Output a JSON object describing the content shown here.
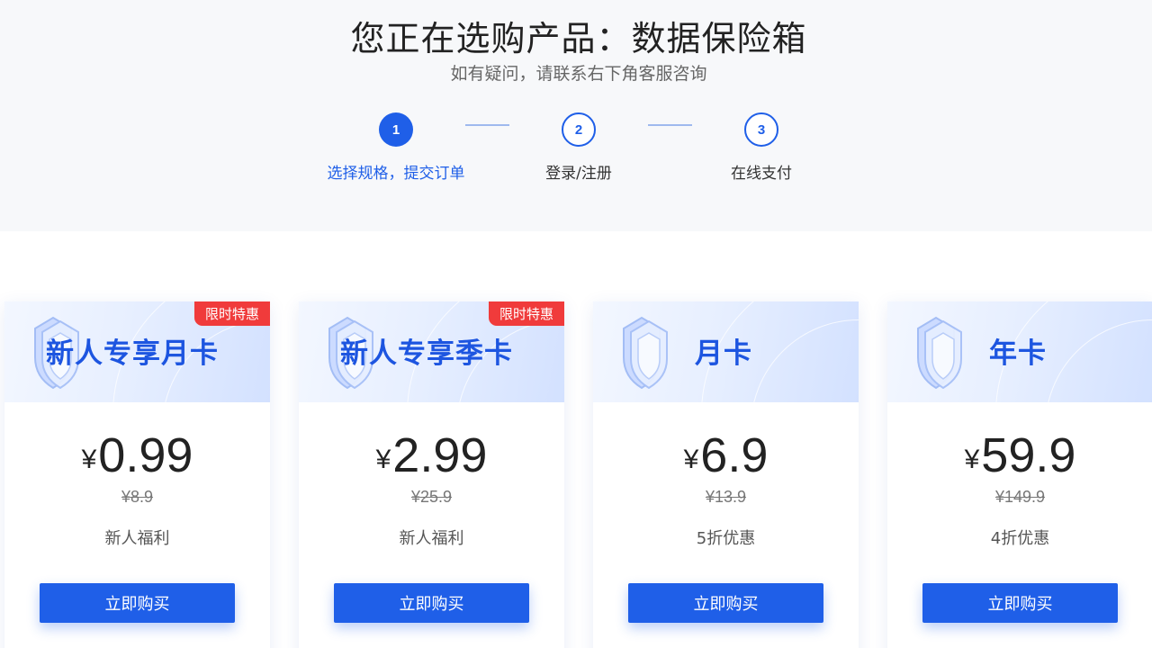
{
  "header": {
    "title": "您正在选购产品：数据保险箱",
    "subtitle": "如有疑问，请联系右下角客服咨询"
  },
  "steps": [
    {
      "number": "1",
      "label": "选择规格，提交订单",
      "state": "active"
    },
    {
      "number": "2",
      "label": "登录/注册",
      "state": "todo"
    },
    {
      "number": "3",
      "label": "在线支付",
      "state": "todo"
    }
  ],
  "currency_symbol": "¥",
  "plans": [
    {
      "name": "新人专享月卡",
      "badge": "限时特惠",
      "price": "0.99",
      "original_price": "¥8.9",
      "note": "新人福利",
      "button": "立即购买"
    },
    {
      "name": "新人专享季卡",
      "badge": "限时特惠",
      "price": "2.99",
      "original_price": "¥25.9",
      "note": "新人福利",
      "button": "立即购买"
    },
    {
      "name": "月卡",
      "badge": "",
      "price": "6.9",
      "original_price": "¥13.9",
      "note": "5折优惠",
      "button": "立即购买"
    },
    {
      "name": "年卡",
      "badge": "",
      "price": "59.9",
      "original_price": "¥149.9",
      "note": "4折优惠",
      "button": "立即购买"
    }
  ],
  "colors": {
    "accent": "#1f5fe8",
    "badge": "#f03b3b",
    "header_bg": "#f7f8fa"
  },
  "icons": {
    "plan_icon": "shield-icon"
  }
}
